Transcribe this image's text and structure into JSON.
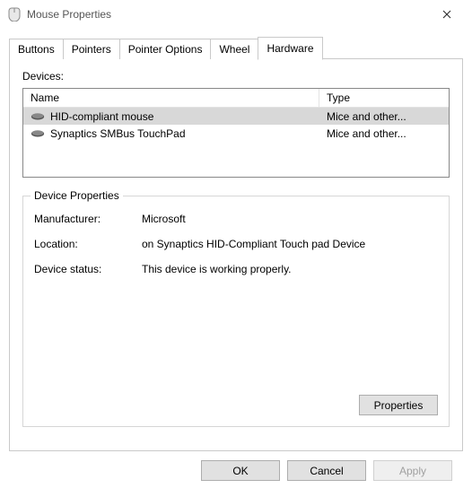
{
  "window": {
    "title": "Mouse Properties"
  },
  "tabs": {
    "buttons": "Buttons",
    "pointers": "Pointers",
    "pointer_options": "Pointer Options",
    "wheel": "Wheel",
    "hardware": "Hardware"
  },
  "devices": {
    "label": "Devices:",
    "columns": {
      "name": "Name",
      "type": "Type"
    },
    "rows": [
      {
        "name": "HID-compliant mouse",
        "type": "Mice and other..."
      },
      {
        "name": "Synaptics SMBus TouchPad",
        "type": "Mice and other..."
      }
    ]
  },
  "device_properties": {
    "legend": "Device Properties",
    "manufacturer_label": "Manufacturer:",
    "manufacturer_value": "Microsoft",
    "location_label": "Location:",
    "location_value": "on Synaptics HID-Compliant Touch pad Device",
    "status_label": "Device status:",
    "status_value": "This device is working properly.",
    "properties_button": "Properties"
  },
  "dialog": {
    "ok": "OK",
    "cancel": "Cancel",
    "apply": "Apply"
  }
}
